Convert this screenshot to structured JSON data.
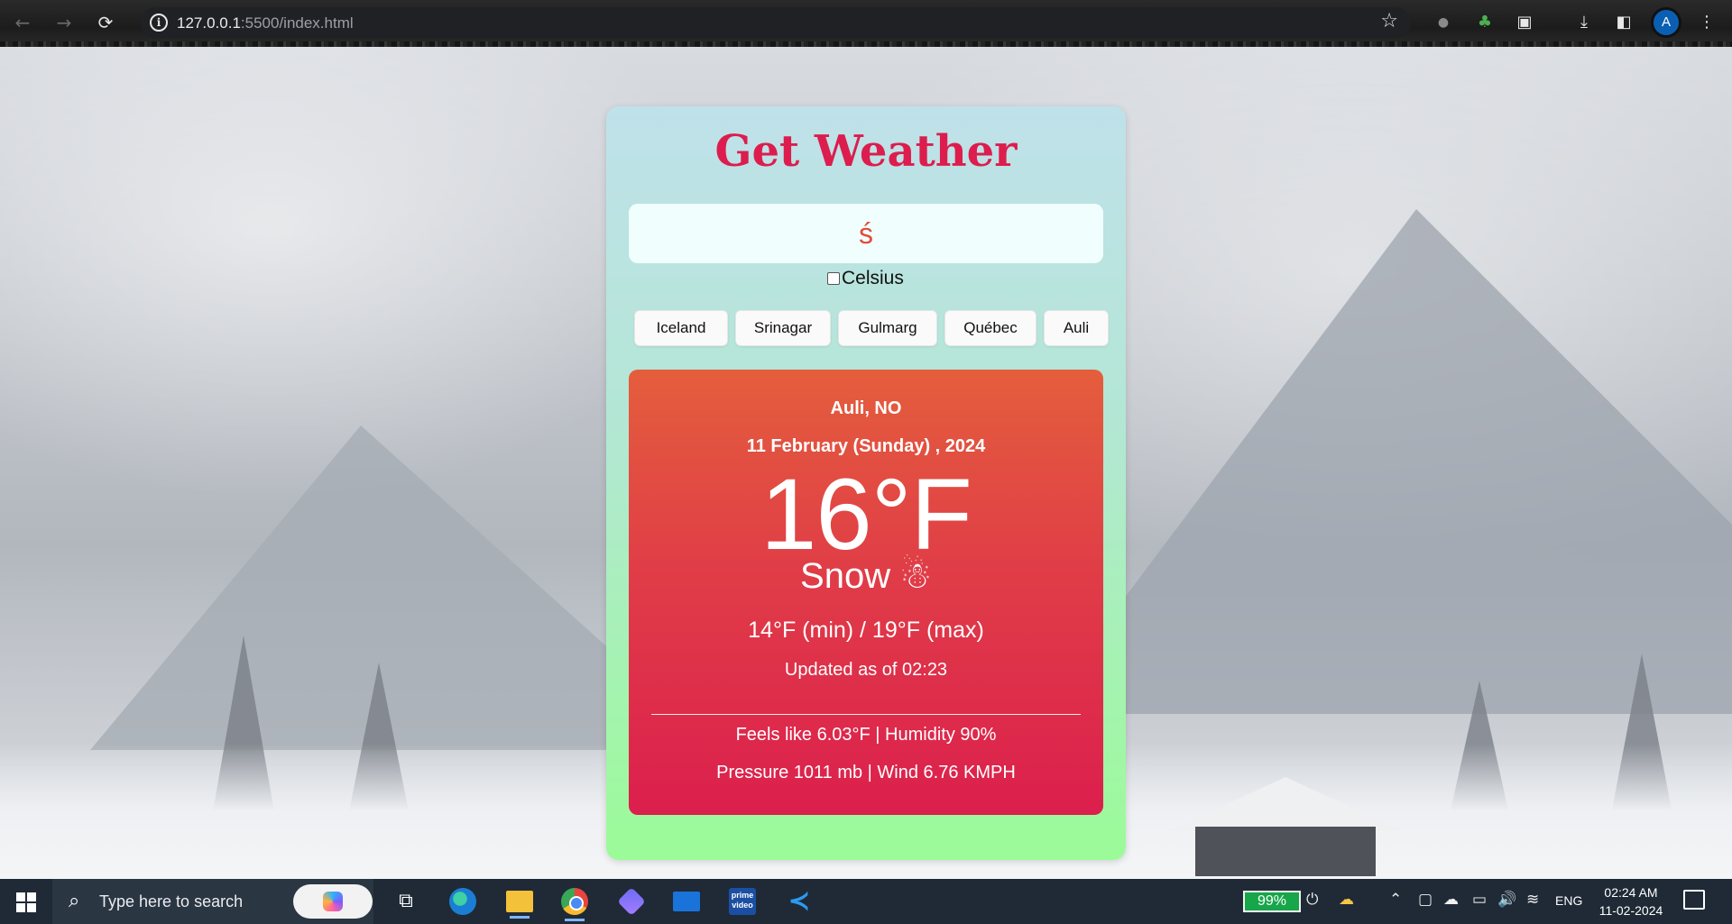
{
  "browser": {
    "url_host": "127.0.0.1",
    "url_path": ":5500/index.html",
    "back_icon": "←",
    "forward_icon": "→",
    "reload_icon": "⟳",
    "info_icon": "i",
    "star_icon": "☆",
    "avatar_letter": "A"
  },
  "app": {
    "title": "Get Weather",
    "search_value": "ś",
    "celsius_label": "Celsius",
    "celsius_checked": false,
    "cities": [
      "Iceland",
      "Srinagar",
      "Gulmarg",
      "Québec",
      "Auli"
    ]
  },
  "weather": {
    "location": "Auli, NO",
    "date": "11 February (Sunday) , 2024",
    "temperature": "16°F",
    "condition": "Snow",
    "condition_emoji": "☃",
    "min_max": "14°F (min) / 19°F (max)",
    "updated": "Updated as of 02:23",
    "feels_humidity": "Feels like 6.03°F | Humidity 90%",
    "pressure_wind": "Pressure 1011 mb | Wind 6.76 KMPH"
  },
  "taskbar": {
    "search_placeholder": "Type here to search",
    "battery": "99%",
    "language": "ENG",
    "time": "02:24 AM",
    "date": "11-02-2024",
    "vscode_glyph": "≺",
    "prime_text": "prime video"
  },
  "colors": {
    "title": "#dc1d4d",
    "card_top": "#bfe1ea",
    "card_bottom": "#9bfb98",
    "weather_top": "#e45e3c",
    "weather_bottom": "#dc1f4d"
  }
}
